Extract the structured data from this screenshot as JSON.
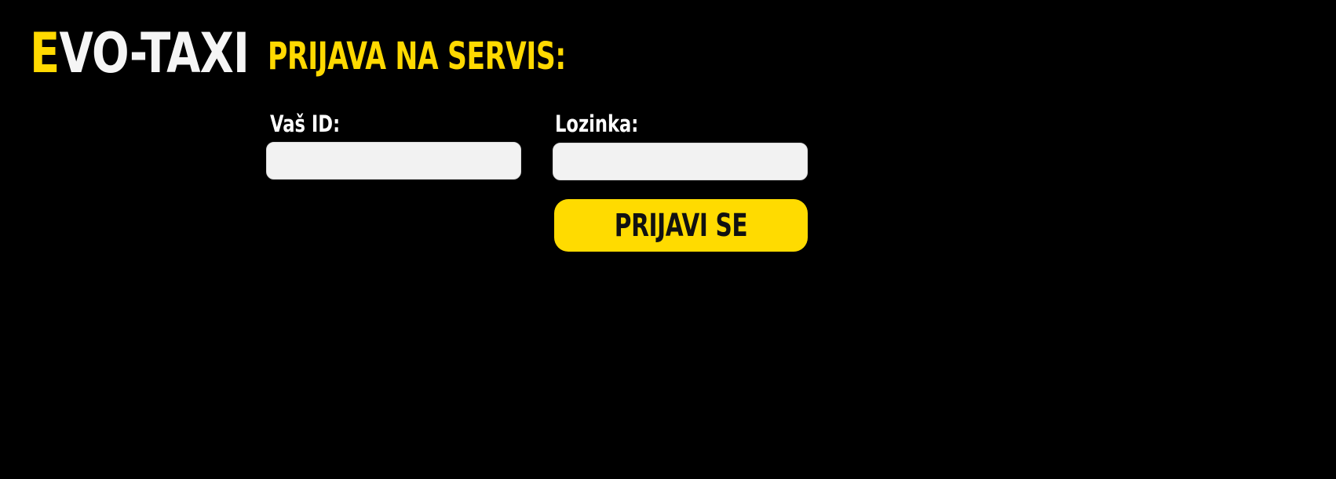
{
  "brand": {
    "logo_accent": "E",
    "logo_rest": "VO-TAXI",
    "accent_color": "#FFD900",
    "background_color": "#000000"
  },
  "login": {
    "title": "PRIJAVA NA SERVIS:",
    "id_label": "Vaš ID:",
    "id_value": "",
    "password_label": "Lozinka:",
    "password_value": "",
    "submit_label": "PRIJAVI SE"
  }
}
